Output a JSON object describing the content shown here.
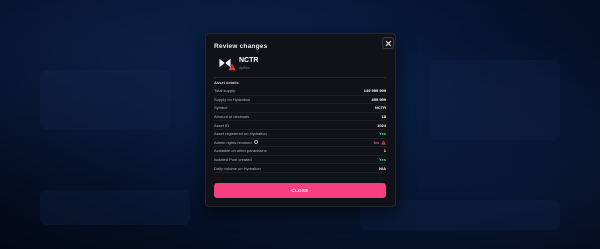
{
  "modal": {
    "title": "Review changes",
    "close_icon": "close-icon"
  },
  "asset": {
    "symbol": "NCTR",
    "name": "Apillon",
    "logo_icon": "nectar-logo-icon",
    "warning_icon": "warning-triangle-icon"
  },
  "details": {
    "section_label": "Asset details",
    "rows": [
      {
        "label": "Total supply",
        "value": "149 999 999",
        "tone": "default"
      },
      {
        "label": "Supply on Hydration",
        "value": "499 999",
        "tone": "default"
      },
      {
        "label": "Symbol",
        "value": "NCTR",
        "tone": "default"
      },
      {
        "label": "Amount of decimals",
        "value": "18",
        "tone": "default"
      },
      {
        "label": "Asset ID",
        "value": "1024",
        "tone": "default"
      },
      {
        "label": "Asset registered on Hydration",
        "value": "Yes",
        "tone": "yes"
      },
      {
        "label": "Admin rights revoked",
        "value": "No",
        "tone": "no",
        "label_icon": "info-icon",
        "value_icon": "warning-triangle-icon"
      },
      {
        "label": "Available on other parachains",
        "value": "1",
        "tone": "default"
      },
      {
        "label": "Isolated Pool created",
        "value": "Yes",
        "tone": "yes"
      },
      {
        "label": "Daily volume on Hydration",
        "value": "N/A",
        "tone": "default"
      }
    ]
  },
  "actions": {
    "close_label": "CLOSE"
  },
  "colors": {
    "accent": "#f4407f",
    "yes": "#58e0a9",
    "no": "#f1497f",
    "warning": "#e8433f"
  }
}
